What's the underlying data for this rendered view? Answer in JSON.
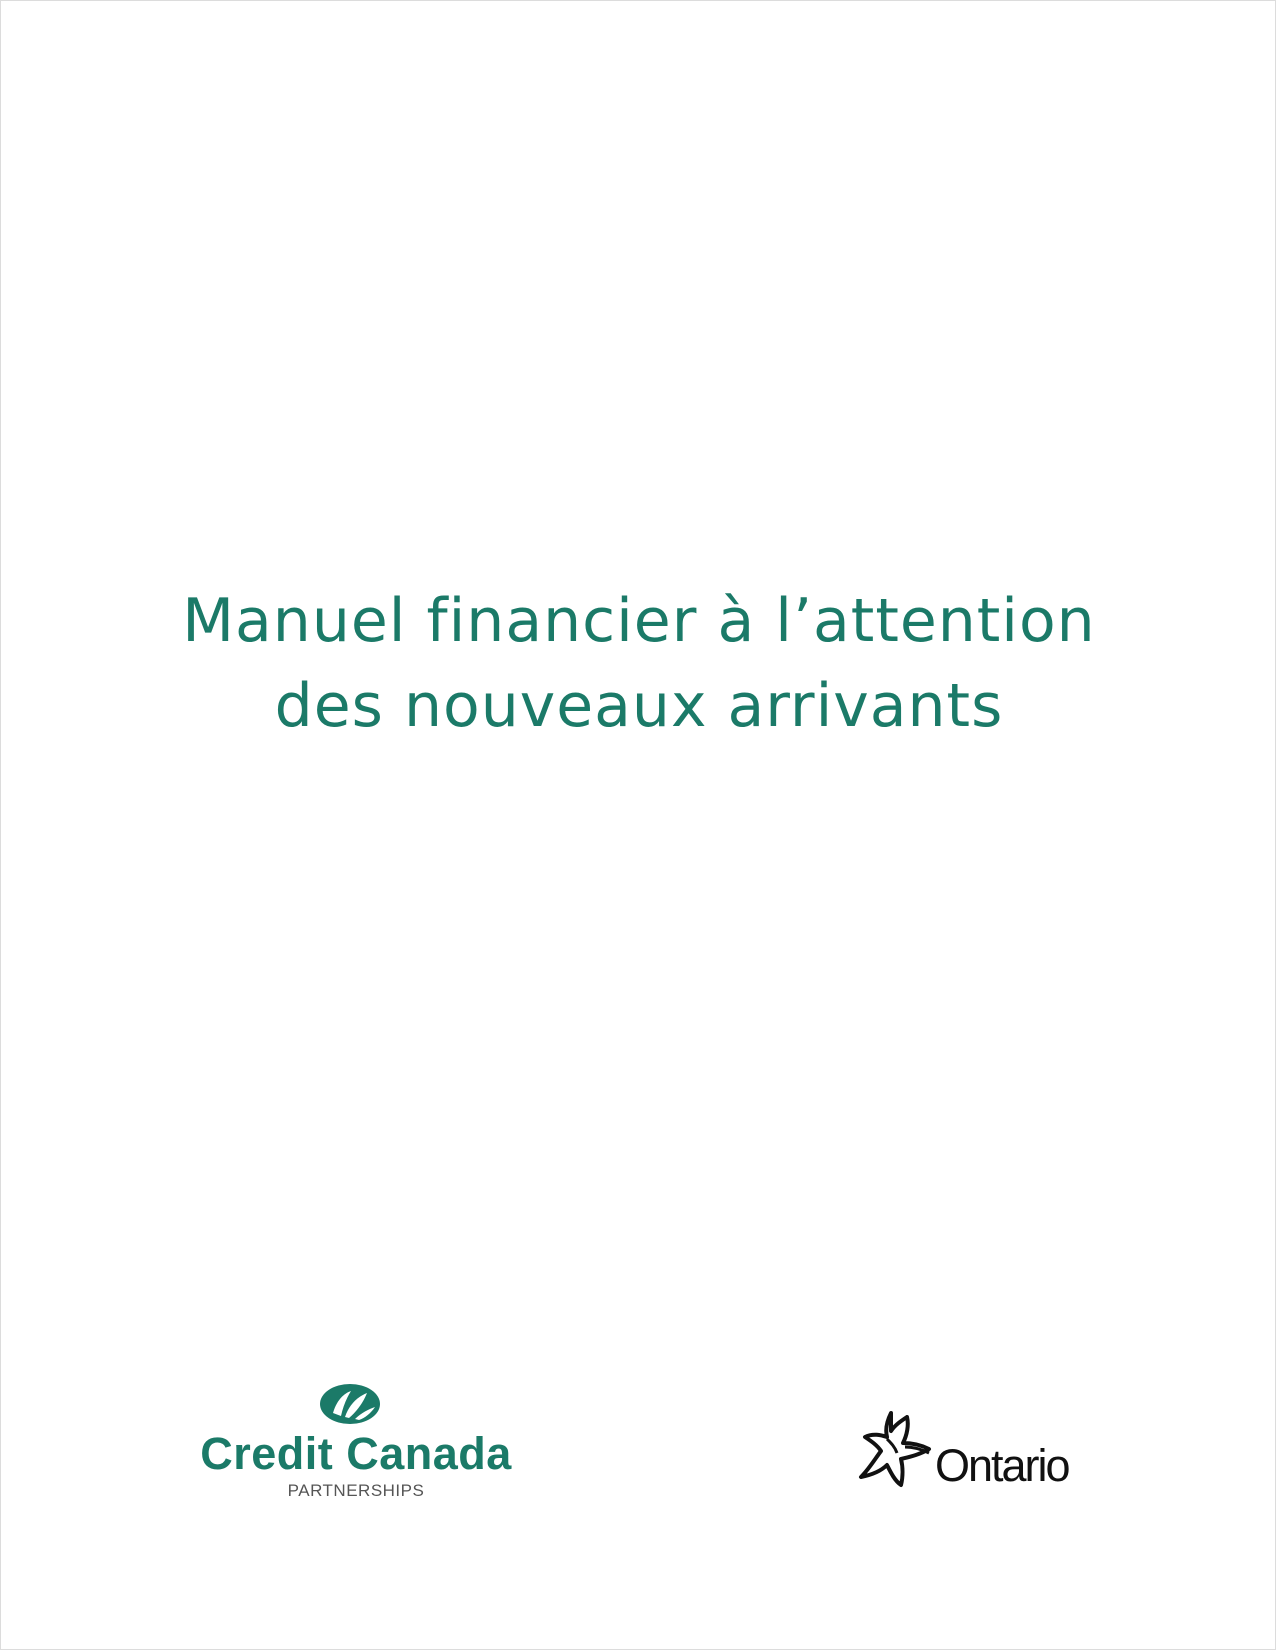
{
  "document": {
    "title_lines": [
      "Manuel financier à l’attention",
      "des nouveaux arrivants"
    ]
  },
  "logos": {
    "credit_canada": {
      "name": "Credit Canada",
      "subtitle": "PARTNERSHIPS",
      "icon": "leaf-icon",
      "color": "#1b7a68"
    },
    "ontario": {
      "name": "Ontario",
      "icon": "trillium-icon",
      "color": "#111111"
    }
  },
  "colors": {
    "title": "#1b7a68",
    "page_background": "#ffffff"
  }
}
